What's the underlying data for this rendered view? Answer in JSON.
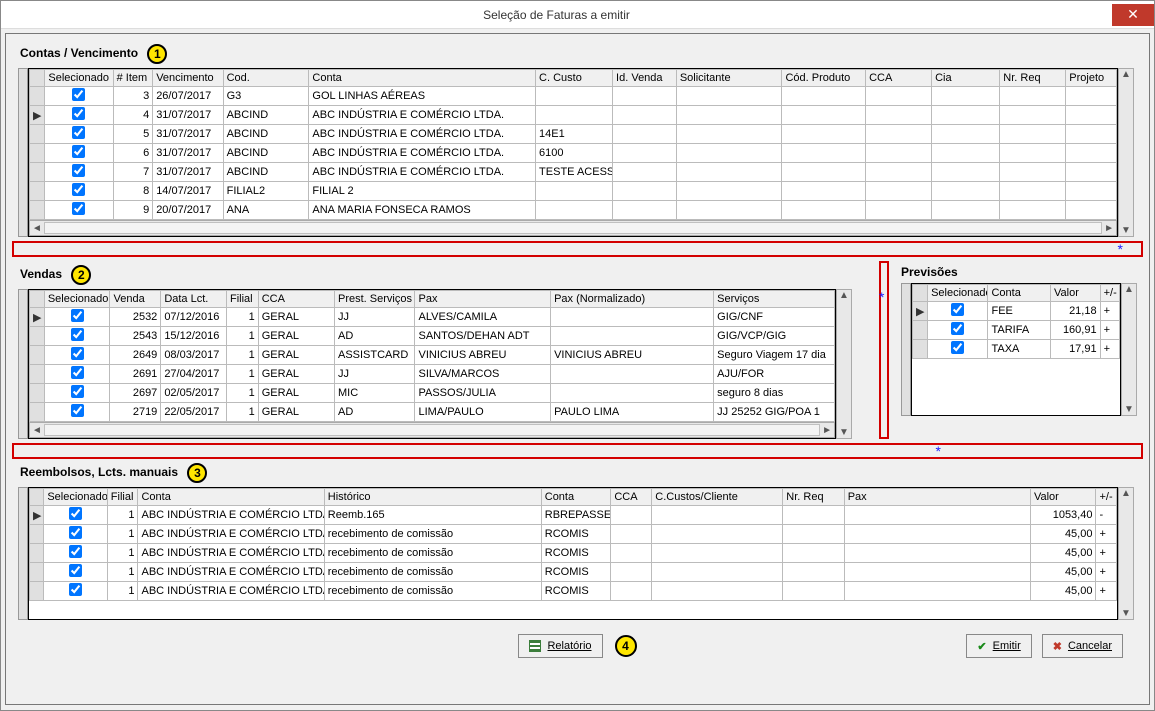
{
  "titlebar": {
    "title": "Seleção de Faturas a emitir",
    "close_symbol": "✕"
  },
  "badges": {
    "b1": "1",
    "b2": "2",
    "b3": "3",
    "b4": "4"
  },
  "sections": {
    "contas": "Contas / Vencimento",
    "vendas": "Vendas",
    "previsoes": "Previsões",
    "reembolsos": "Reembolsos, Lcts. manuais"
  },
  "contas_headers": {
    "selecionado": "Selecionado",
    "item": "# Item",
    "venc": "Vencimento",
    "cod": "Cod.",
    "conta": "Conta",
    "ccusto": "C. Custo",
    "idvenda": "Id. Venda",
    "solic": "Solicitante",
    "codprod": "Cód. Produto",
    "cca": "CCA",
    "cia": "Cia",
    "nrreq": "Nr. Req",
    "projeto": "Projeto"
  },
  "contas_rows": [
    {
      "mark": "",
      "sel": true,
      "item": "3",
      "venc": "26/07/2017",
      "cod": "G3",
      "conta": "GOL LINHAS AÉREAS",
      "ccusto": "",
      "idv": "",
      "sol": "",
      "codp": "",
      "cca": "",
      "cia": "",
      "nrreq": "",
      "proj": ""
    },
    {
      "mark": "▶",
      "sel": true,
      "item": "4",
      "venc": "31/07/2017",
      "cod": "ABCIND",
      "conta": "ABC INDÚSTRIA E COMÉRCIO LTDA.",
      "ccusto": "",
      "idv": "",
      "sol": "",
      "codp": "",
      "cca": "",
      "cia": "",
      "nrreq": "",
      "proj": ""
    },
    {
      "mark": "",
      "sel": true,
      "item": "5",
      "venc": "31/07/2017",
      "cod": "ABCIND",
      "conta": "ABC INDÚSTRIA E COMÉRCIO LTDA.",
      "ccusto": "14E1",
      "idv": "",
      "sol": "",
      "codp": "",
      "cca": "",
      "cia": "",
      "nrreq": "",
      "proj": ""
    },
    {
      "mark": "",
      "sel": true,
      "item": "6",
      "venc": "31/07/2017",
      "cod": "ABCIND",
      "conta": "ABC INDÚSTRIA E COMÉRCIO LTDA.",
      "ccusto": "6100",
      "idv": "",
      "sol": "",
      "codp": "",
      "cca": "",
      "cia": "",
      "nrreq": "",
      "proj": ""
    },
    {
      "mark": "",
      "sel": true,
      "item": "7",
      "venc": "31/07/2017",
      "cod": "ABCIND",
      "conta": "ABC INDÚSTRIA E COMÉRCIO LTDA.",
      "ccusto": "TESTE ACESS",
      "idv": "",
      "sol": "",
      "codp": "",
      "cca": "",
      "cia": "",
      "nrreq": "",
      "proj": ""
    },
    {
      "mark": "",
      "sel": true,
      "item": "8",
      "venc": "14/07/2017",
      "cod": "FILIAL2",
      "conta": "FILIAL 2",
      "ccusto": "",
      "idv": "",
      "sol": "",
      "codp": "",
      "cca": "",
      "cia": "",
      "nrreq": "",
      "proj": ""
    },
    {
      "mark": "",
      "sel": true,
      "item": "9",
      "venc": "20/07/2017",
      "cod": "ANA",
      "conta": "ANA MARIA FONSECA RAMOS",
      "ccusto": "",
      "idv": "",
      "sol": "",
      "codp": "",
      "cca": "",
      "cia": "",
      "nrreq": "",
      "proj": ""
    }
  ],
  "vendas_headers": {
    "selecionado": "Selecionado",
    "venda": "Venda",
    "data": "Data Lct.",
    "filial": "Filial",
    "cca": "CCA",
    "prest": "Prest. Serviços",
    "pax": "Pax",
    "paxnorm": "Pax (Normalizado)",
    "serv": "Serviços"
  },
  "vendas_rows": [
    {
      "mark": "▶",
      "sel": true,
      "venda": "2532",
      "data": "07/12/2016",
      "filial": "1",
      "cca": "GERAL",
      "prest": "JJ",
      "pax": "ALVES/CAMILA",
      "paxnorm": "",
      "serv": "GIG/CNF"
    },
    {
      "mark": "",
      "sel": true,
      "venda": "2543",
      "data": "15/12/2016",
      "filial": "1",
      "cca": "GERAL",
      "prest": "AD",
      "pax": "SANTOS/DEHAN ADT",
      "paxnorm": "",
      "serv": "GIG/VCP/GIG"
    },
    {
      "mark": "",
      "sel": true,
      "venda": "2649",
      "data": "08/03/2017",
      "filial": "1",
      "cca": "GERAL",
      "prest": "ASSISTCARD",
      "pax": "VINICIUS ABREU",
      "paxnorm": "VINICIUS ABREU",
      "serv": "Seguro Viagem 17 dia"
    },
    {
      "mark": "",
      "sel": true,
      "venda": "2691",
      "data": "27/04/2017",
      "filial": "1",
      "cca": "GERAL",
      "prest": "JJ",
      "pax": "SILVA/MARCOS",
      "paxnorm": "",
      "serv": "AJU/FOR"
    },
    {
      "mark": "",
      "sel": true,
      "venda": "2697",
      "data": "02/05/2017",
      "filial": "1",
      "cca": "GERAL",
      "prest": "MIC",
      "pax": "PASSOS/JULIA",
      "paxnorm": "",
      "serv": "seguro 8 dias"
    },
    {
      "mark": "",
      "sel": true,
      "venda": "2719",
      "data": "22/05/2017",
      "filial": "1",
      "cca": "GERAL",
      "prest": "AD",
      "pax": "LIMA/PAULO",
      "paxnorm": "PAULO LIMA",
      "serv": "JJ 25252 GIG/POA 1"
    }
  ],
  "prev_headers": {
    "sel": "Selecionado",
    "conta": "Conta",
    "valor": "Valor",
    "pm": "+/-"
  },
  "prev_rows": [
    {
      "mark": "▶",
      "sel": true,
      "conta": "FEE",
      "valor": "21,18",
      "pm": "+"
    },
    {
      "mark": "",
      "sel": true,
      "conta": "TARIFA",
      "valor": "160,91",
      "pm": "+"
    },
    {
      "mark": "",
      "sel": true,
      "conta": "TAXA",
      "valor": "17,91",
      "pm": "+"
    }
  ],
  "reemb_headers": {
    "sel": "Selecionado",
    "filial": "Filial",
    "conta": "Conta",
    "hist": "Histórico",
    "conta2": "Conta",
    "cca": "CCA",
    "ccustos": "C.Custos/Cliente",
    "nrreq": "Nr. Req",
    "pax": "Pax",
    "valor": "Valor",
    "pm": "+/-"
  },
  "reemb_rows": [
    {
      "mark": "▶",
      "sel": true,
      "filial": "1",
      "conta": "ABC INDÚSTRIA E COMÉRCIO LTDA",
      "hist": "Reemb.165",
      "conta2": "RBREPASSE",
      "cca": "",
      "cc": "",
      "nrreq": "",
      "pax": "",
      "valor": "1053,40",
      "pm": "-"
    },
    {
      "mark": "",
      "sel": true,
      "filial": "1",
      "conta": "ABC INDÚSTRIA E COMÉRCIO LTDA",
      "hist": "recebimento de comissão",
      "conta2": "RCOMIS",
      "cca": "",
      "cc": "",
      "nrreq": "",
      "pax": "",
      "valor": "45,00",
      "pm": "+"
    },
    {
      "mark": "",
      "sel": true,
      "filial": "1",
      "conta": "ABC INDÚSTRIA E COMÉRCIO LTDA",
      "hist": "recebimento de comissão",
      "conta2": "RCOMIS",
      "cca": "",
      "cc": "",
      "nrreq": "",
      "pax": "",
      "valor": "45,00",
      "pm": "+"
    },
    {
      "mark": "",
      "sel": true,
      "filial": "1",
      "conta": "ABC INDÚSTRIA E COMÉRCIO LTDA",
      "hist": "recebimento de comissão",
      "conta2": "RCOMIS",
      "cca": "",
      "cc": "",
      "nrreq": "",
      "pax": "",
      "valor": "45,00",
      "pm": "+"
    },
    {
      "mark": "",
      "sel": true,
      "filial": "1",
      "conta": "ABC INDÚSTRIA E COMÉRCIO LTDA",
      "hist": "recebimento de comissão",
      "conta2": "RCOMIS",
      "cca": "",
      "cc": "",
      "nrreq": "",
      "pax": "",
      "valor": "45,00",
      "pm": "+"
    }
  ],
  "buttons": {
    "relatorio": "Relatório",
    "emitir": "Emitir",
    "cancelar": "Cancelar"
  }
}
